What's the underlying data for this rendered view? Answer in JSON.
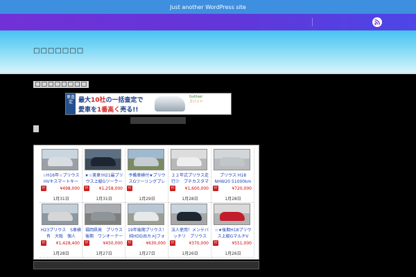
{
  "topbar": {
    "tagline": "Just another WordPress site"
  },
  "nav": {
    "rss_icon": "rss-icon"
  },
  "header": {
    "site_title": "□□□□□□□"
  },
  "widget": {
    "title": "□□□□□□□□"
  },
  "banner": {
    "tag": "車査定",
    "line1_a": "最大",
    "line1_b": "10社",
    "line1_c": "の一括査定で",
    "line2_a": "愛車を",
    "line2_b": "1番高く",
    "line2_c": "売る!!",
    "logos": "Gulliver",
    "logos2": "ズバット"
  },
  "listing": {
    "items": [
      {
        "title": "☆H16年☆プリウス HVキスマートキー",
        "price": "¥498,000",
        "date": "1月31日",
        "colors": {
          "sky": "#c9d6df",
          "ground": "#9aa0a6",
          "car": "#d9dde2"
        }
      },
      {
        "title": "★☆美車!H21最プリウス上級Gツーラー",
        "price": "¥1,258,000",
        "date": "1月31日",
        "colors": {
          "sky": "#5d6f83",
          "ground": "#3d4a57",
          "car": "#1d2532"
        }
      },
      {
        "title": "予備車検付★プリウスGツーリングプレ",
        "price": "",
        "date": "1月29日",
        "colors": {
          "sky": "#9fb9cf",
          "ground": "#7a8b62",
          "car": "#c7ccd2"
        }
      },
      {
        "title": "２２年式プリウス走行少　ブチカスタマ",
        "price": "¥1,600,000",
        "date": "1月28日",
        "colors": {
          "sky": "#dcdcdc",
          "ground": "#b8b8b8",
          "car": "#eeeeee"
        }
      },
      {
        "title": "プリウス H18 NHW20 51000km",
        "price": "¥720,000",
        "date": "1月28日",
        "colors": {
          "sky": "#d3d6d9",
          "ground": "#b9bcbf",
          "car": "#c3c6c9"
        }
      },
      {
        "title": "H23プリウス　S車検有　大阪　個人",
        "price": "¥1,428,400",
        "date": "1月28日",
        "colors": {
          "sky": "#c2cfd9",
          "ground": "#8d98a0",
          "car": "#d6d6d6"
        }
      },
      {
        "title": "福岡県発　プリウス後期　ワンオーナー",
        "price": "¥450,000",
        "date": "1月27日",
        "colors": {
          "sky": "#a9adb1",
          "ground": "#7f7f7f",
          "car": "#8f9498"
        }
      },
      {
        "title": "19年後期プリウス！純HDD/BカメJフォ",
        "price": "¥630,000",
        "date": "1月27日",
        "colors": {
          "sky": "#b7c6d2",
          "ground": "#9a9f94",
          "car": "#e6e8ea"
        }
      },
      {
        "title": "法人使用！メンテバッチリ　プリウス",
        "price": "¥370,000",
        "date": "1月26日",
        "colors": {
          "sky": "#c7d4dd",
          "ground": "#a6a6a6",
          "car": "#1f2630"
        }
      },
      {
        "title": "☆★後期H18プリウス上級GマルチV",
        "price": "¥551,000",
        "date": "1月26日",
        "colors": {
          "sky": "#d9d9d9",
          "ground": "#b3b3b3",
          "car": "#c21d2c"
        }
      }
    ]
  }
}
